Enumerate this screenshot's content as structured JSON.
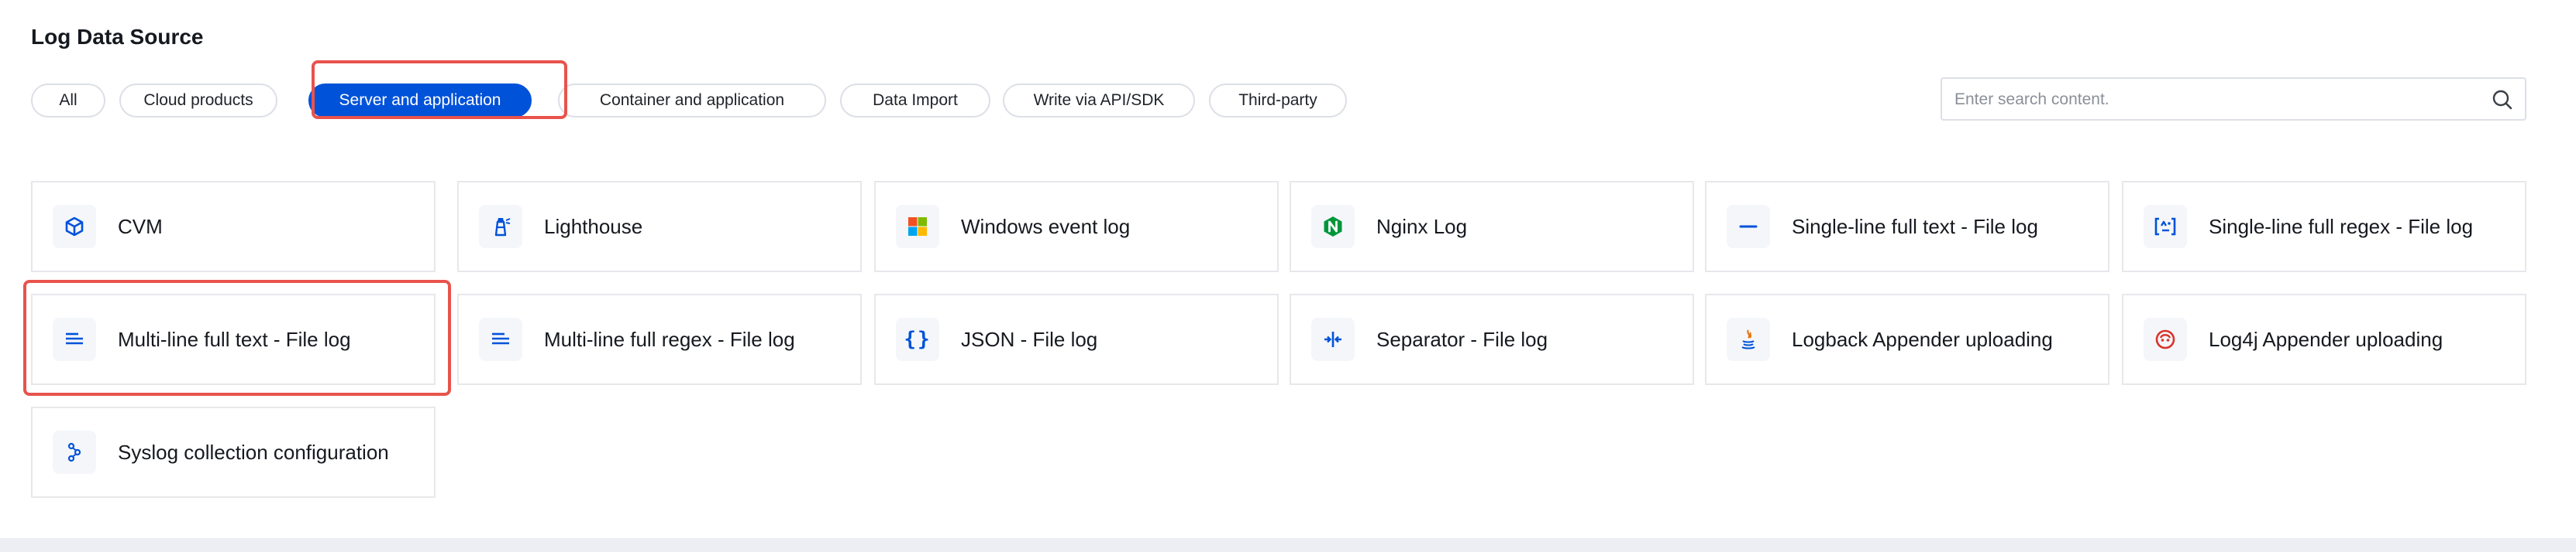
{
  "page_title": "Log Data Source",
  "filters": [
    {
      "label": "All"
    },
    {
      "label": "Cloud products"
    },
    {
      "label": "Server and application",
      "active": true
    },
    {
      "label": "Container and application"
    },
    {
      "label": "Data Import"
    },
    {
      "label": "Write via API/SDK"
    },
    {
      "label": "Third-party"
    }
  ],
  "search": {
    "placeholder": "Enter search content.",
    "icon": "search-icon"
  },
  "sources": [
    {
      "label": "CVM",
      "icon": "cvm-icon"
    },
    {
      "label": "Lighthouse",
      "icon": "lighthouse-icon"
    },
    {
      "label": "Windows event log",
      "icon": "windows-icon"
    },
    {
      "label": "Nginx Log",
      "icon": "nginx-icon"
    },
    {
      "label": "Single-line full text - File log",
      "icon": "single-line-icon"
    },
    {
      "label": "Single-line full regex - File log",
      "icon": "regex-icon"
    },
    {
      "label": "Multi-line full text - File log",
      "icon": "multi-line-icon"
    },
    {
      "label": "Multi-line full regex - File log",
      "icon": "multi-line-regex-icon"
    },
    {
      "label": "JSON - File log",
      "icon": "json-icon"
    },
    {
      "label": "Separator - File log",
      "icon": "separator-icon"
    },
    {
      "label": "Logback Appender uploading",
      "icon": "java-icon"
    },
    {
      "label": "Log4j Appender uploading",
      "icon": "log4j-icon"
    },
    {
      "label": "Syslog collection configuration",
      "icon": "syslog-icon"
    }
  ],
  "colors": {
    "accent": "#0052d9",
    "highlight": "#e8534c",
    "nginx": "#009639",
    "log4j": "#d9342b"
  }
}
